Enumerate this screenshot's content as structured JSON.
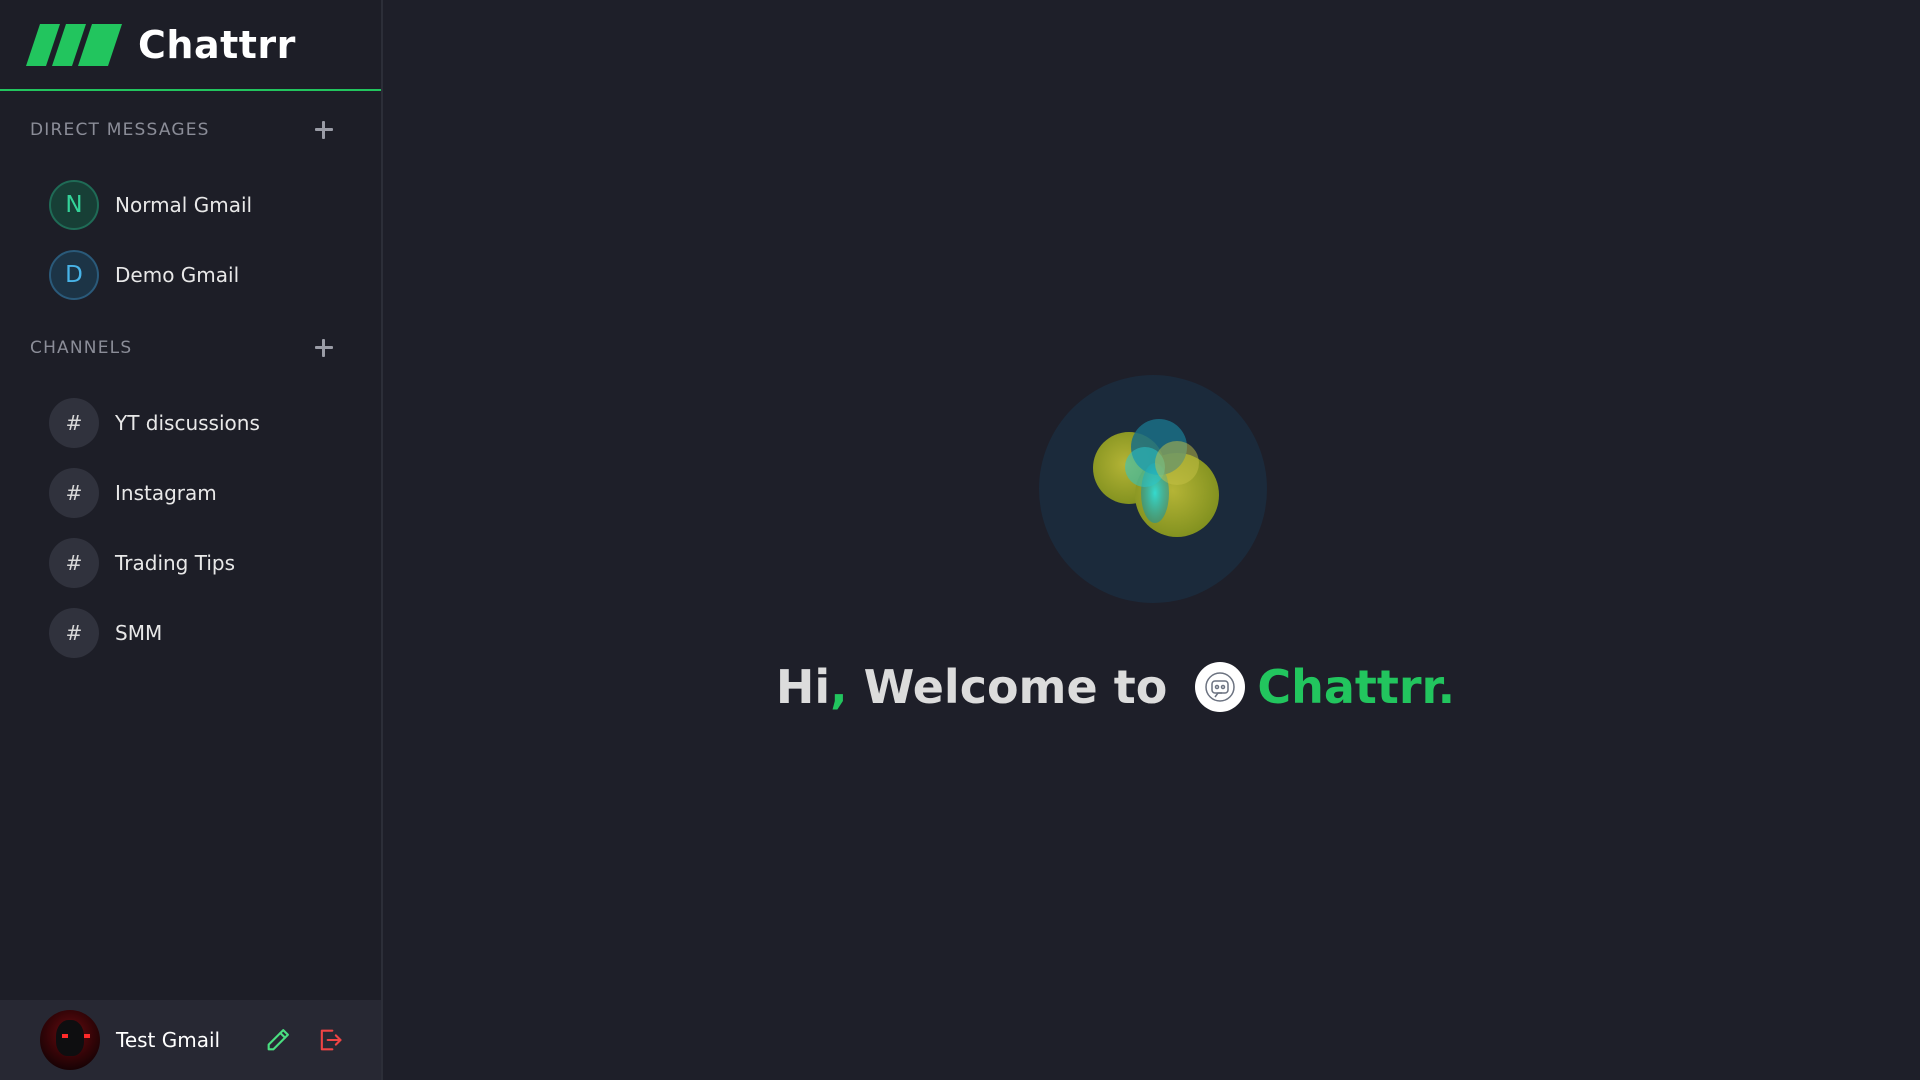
{
  "app": {
    "name": "Chattrr",
    "accent_color": "#22c55e"
  },
  "sidebar": {
    "direct_messages": {
      "title": "DIRECT MESSAGES",
      "add_icon": "plus-icon",
      "items": [
        {
          "initial": "N",
          "label": "Normal Gmail"
        },
        {
          "initial": "D",
          "label": "Demo Gmail"
        }
      ]
    },
    "channels": {
      "title": "CHANNELS",
      "add_icon": "plus-icon",
      "items": [
        {
          "symbol": "#",
          "label": "YT discussions"
        },
        {
          "symbol": "#",
          "label": "Instagram"
        },
        {
          "symbol": "#",
          "label": "Trading Tips"
        },
        {
          "symbol": "#",
          "label": "SMM"
        }
      ]
    }
  },
  "footer": {
    "user_name": "Test Gmail",
    "edit_icon": "pencil-icon",
    "logout_icon": "logout-icon"
  },
  "main": {
    "welcome_prefix": "Hi",
    "welcome_comma": ",",
    "welcome_middle": " Welcome to ",
    "welcome_brand": "Chattrr."
  }
}
